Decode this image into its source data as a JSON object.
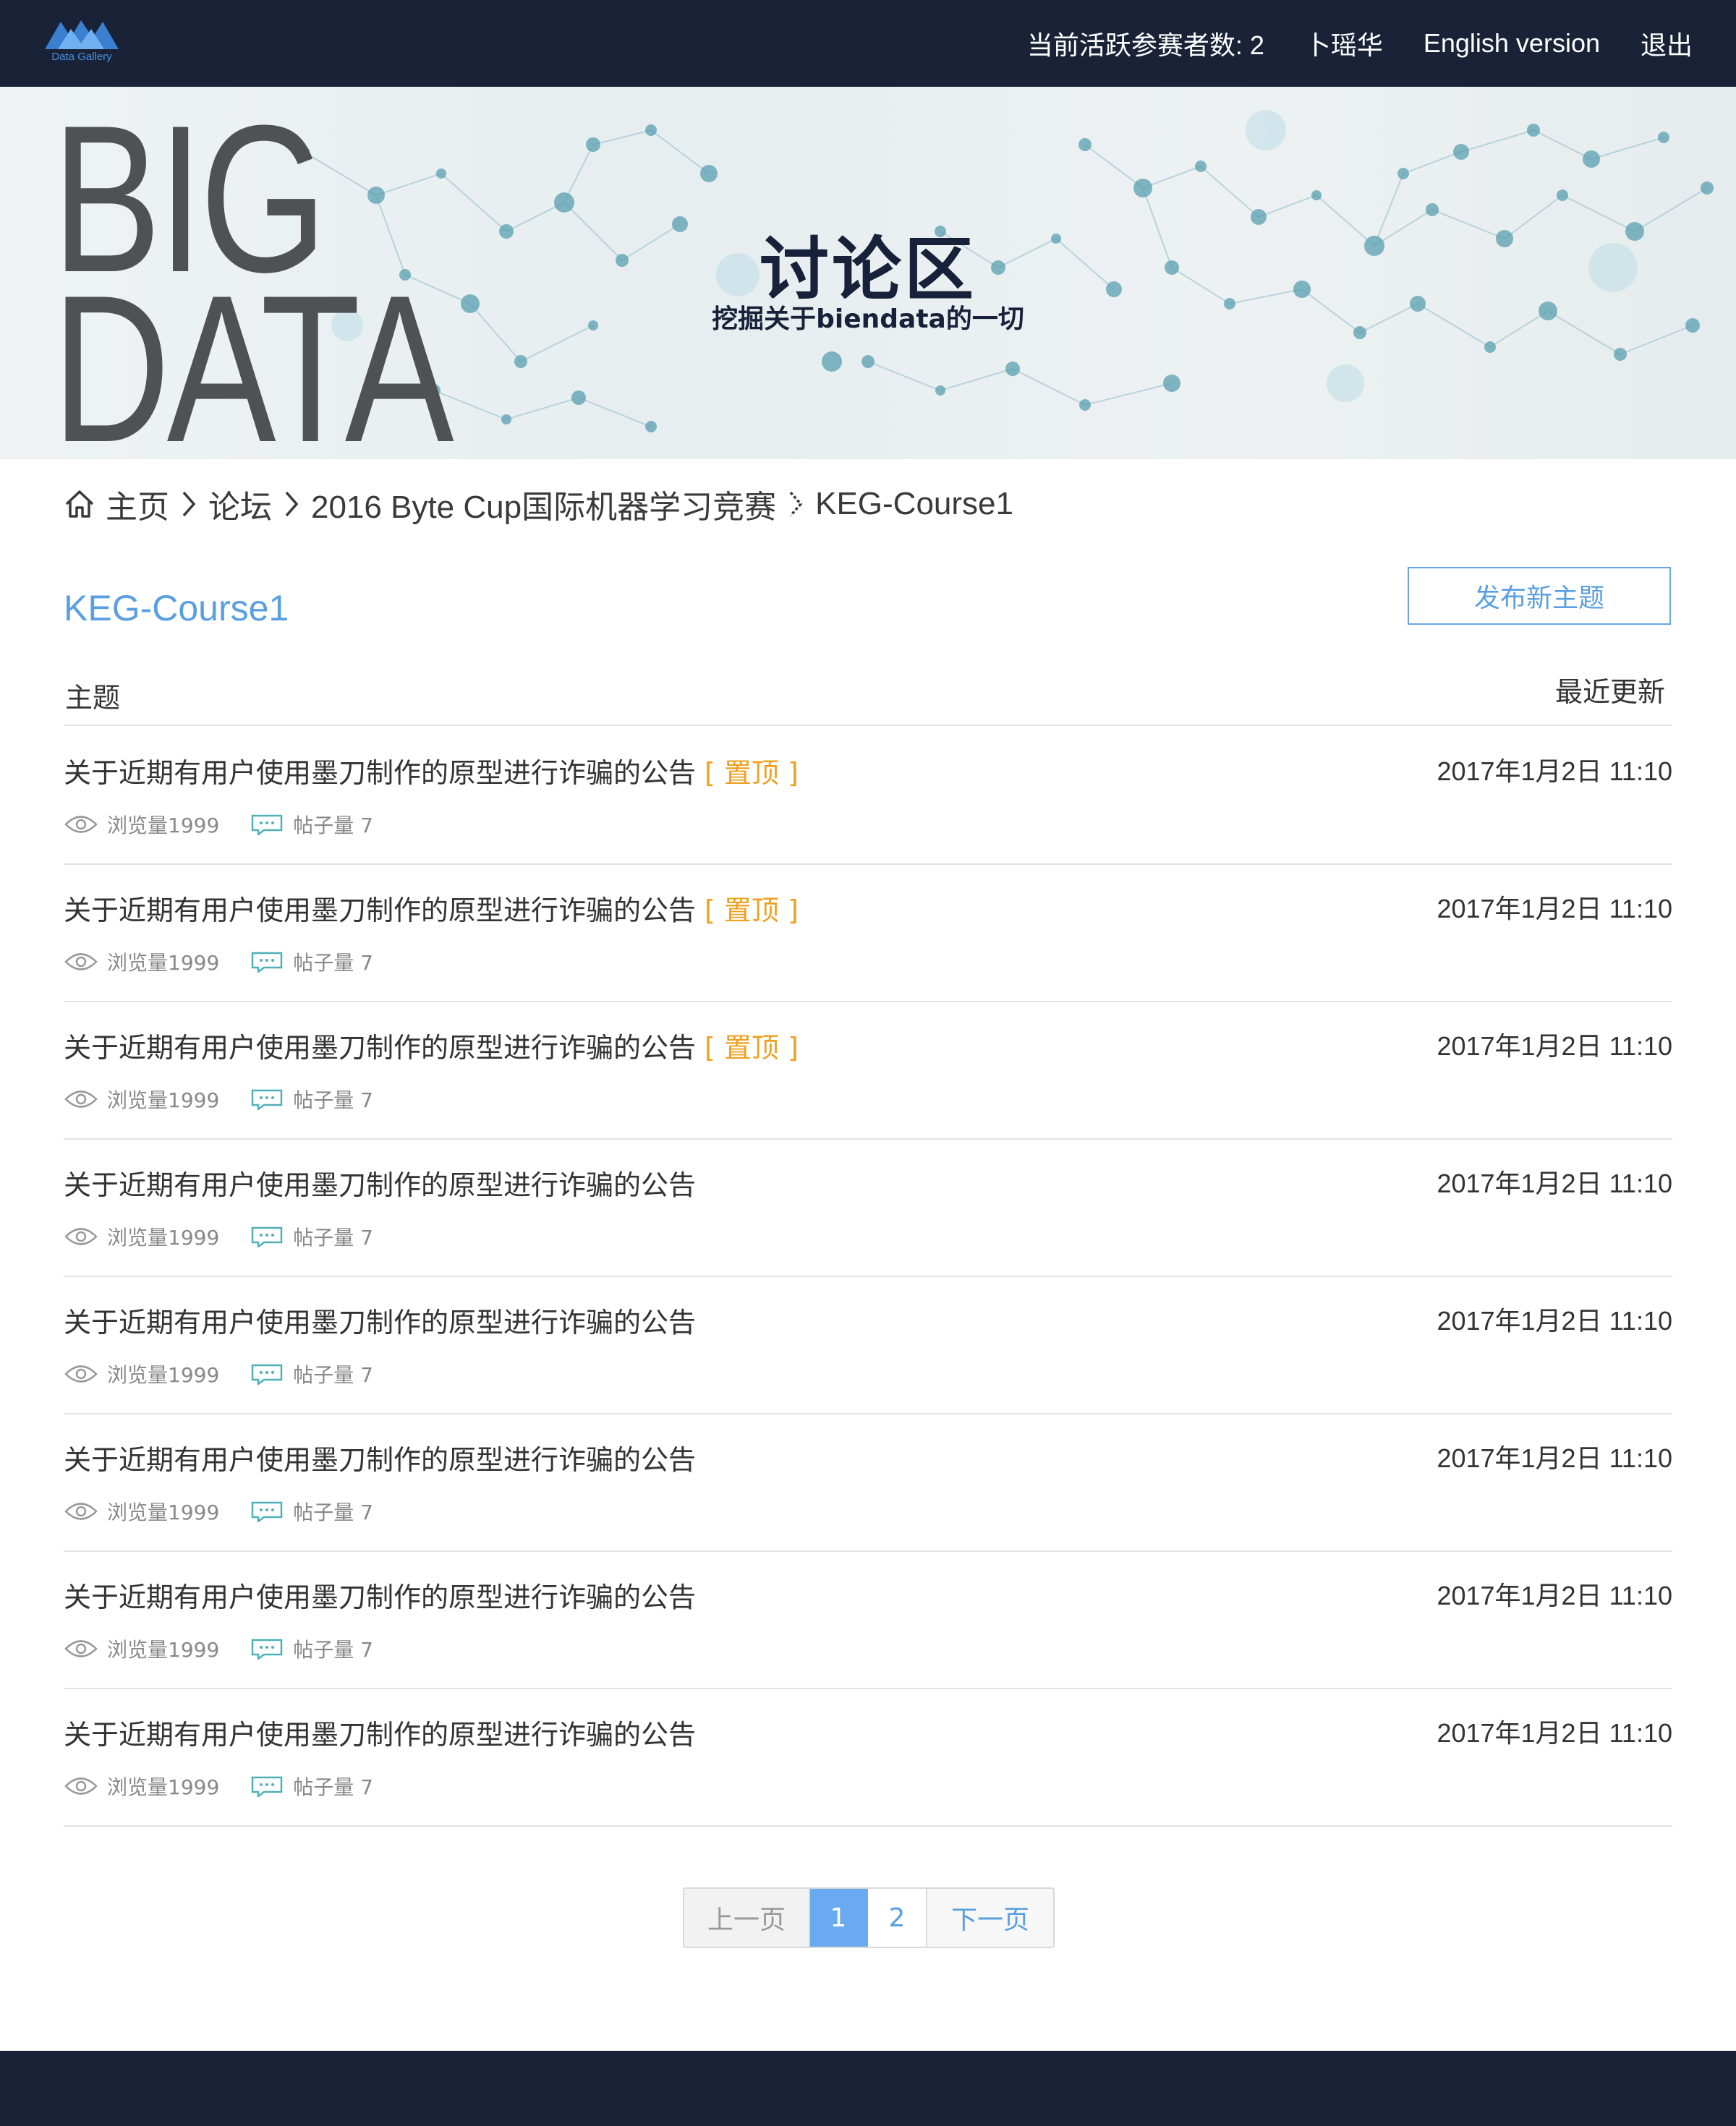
{
  "nav": {
    "logo_text": "Data Gallery",
    "active_participants": "当前活跃参赛者数: 2",
    "username": "卜瑶华",
    "language": "English version",
    "logout": "退出"
  },
  "hero": {
    "big_line1": "BIG",
    "big_line2": "DATA",
    "title": "讨论区",
    "subtitle": "挖掘关于biendata的一切"
  },
  "breadcrumb": {
    "home": "主页",
    "forum": "论坛",
    "competition": "2016 Byte Cup国际机器学习竞赛",
    "current": "KEG-Course1"
  },
  "forum": {
    "title": "KEG-Course1",
    "new_topic": "发布新主题",
    "col_topic": "主题",
    "col_updated": "最近更新"
  },
  "topics": [
    {
      "title": "关于近期有用户使用墨刀制作的原型进行诈骗的公告",
      "pin": "[ 置顶 ]",
      "time": "2017年1月2日 11:10",
      "views": "浏览量1999",
      "posts": "帖子量 7"
    },
    {
      "title": "关于近期有用户使用墨刀制作的原型进行诈骗的公告",
      "pin": "[ 置顶 ]",
      "time": "2017年1月2日 11:10",
      "views": "浏览量1999",
      "posts": "帖子量 7"
    },
    {
      "title": "关于近期有用户使用墨刀制作的原型进行诈骗的公告",
      "pin": "[ 置顶 ]",
      "time": "2017年1月2日 11:10",
      "views": "浏览量1999",
      "posts": "帖子量 7"
    },
    {
      "title": "关于近期有用户使用墨刀制作的原型进行诈骗的公告",
      "pin": "",
      "time": "2017年1月2日 11:10",
      "views": "浏览量1999",
      "posts": "帖子量 7"
    },
    {
      "title": "关于近期有用户使用墨刀制作的原型进行诈骗的公告",
      "pin": "",
      "time": "2017年1月2日 11:10",
      "views": "浏览量1999",
      "posts": "帖子量 7"
    },
    {
      "title": "关于近期有用户使用墨刀制作的原型进行诈骗的公告",
      "pin": "",
      "time": "2017年1月2日 11:10",
      "views": "浏览量1999",
      "posts": "帖子量 7"
    },
    {
      "title": "关于近期有用户使用墨刀制作的原型进行诈骗的公告",
      "pin": "",
      "time": "2017年1月2日 11:10",
      "views": "浏览量1999",
      "posts": "帖子量 7"
    },
    {
      "title": "关于近期有用户使用墨刀制作的原型进行诈骗的公告",
      "pin": "",
      "time": "2017年1月2日 11:10",
      "views": "浏览量1999",
      "posts": "帖子量 7"
    }
  ],
  "pagination": {
    "prev": "上一页",
    "pages": [
      "1",
      "2"
    ],
    "current": "1",
    "next": "下一页"
  },
  "colors": {
    "nav_bg": "#192236",
    "accent": "#5a9fe0",
    "pin": "#f0a020"
  }
}
